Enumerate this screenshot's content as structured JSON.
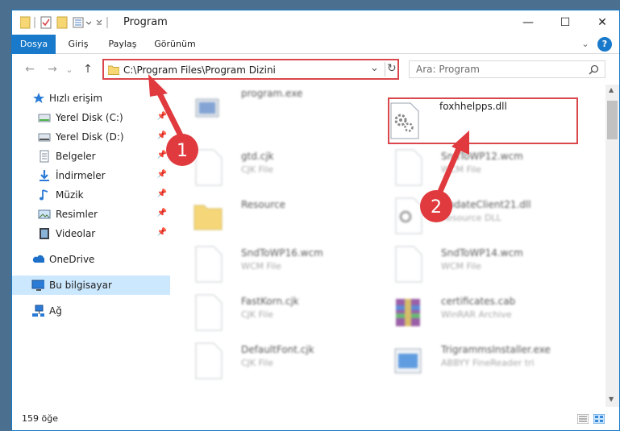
{
  "window": {
    "title": "Program",
    "minimize": "—",
    "maximize": "☐",
    "close": "✕"
  },
  "ribbon": {
    "tabs": [
      {
        "label": "Dosya",
        "active": true
      },
      {
        "label": "Giriş",
        "active": false
      },
      {
        "label": "Paylaş",
        "active": false
      },
      {
        "label": "Görünüm",
        "active": false
      }
    ],
    "expand": "⌄",
    "help": "?"
  },
  "nav": {
    "back": "←",
    "forward": "→",
    "recent": "⌄",
    "up": "↑",
    "address": "C:\\Program Files\\Program Dizini",
    "address_dropdown": "⌄",
    "refresh": "↻",
    "search_placeholder": "Ara: Program"
  },
  "sidebar": {
    "items": [
      {
        "label": "Hızlı erişim",
        "icon": "star-icon",
        "pinned": false
      },
      {
        "label": "Yerel Disk (C:)",
        "icon": "drive-icon",
        "pinned": true
      },
      {
        "label": "Yerel Disk (D:)",
        "icon": "drive-icon",
        "pinned": true
      },
      {
        "label": "Belgeler",
        "icon": "documents-icon",
        "pinned": true
      },
      {
        "label": "İndirmeler",
        "icon": "download-icon",
        "pinned": true
      },
      {
        "label": "Müzik",
        "icon": "music-icon",
        "pinned": true
      },
      {
        "label": "Resimler",
        "icon": "pictures-icon",
        "pinned": true
      },
      {
        "label": "Videolar",
        "icon": "video-icon",
        "pinned": true
      },
      {
        "label": "OneDrive",
        "icon": "cloud-icon",
        "pinned": false
      },
      {
        "label": "Bu bilgisayar",
        "icon": "computer-icon",
        "pinned": false
      },
      {
        "label": "Ağ",
        "icon": "network-icon",
        "pinned": false
      }
    ]
  },
  "files": [
    {
      "name": "program.exe",
      "type": "",
      "icon": "exe-icon",
      "blurred": true
    },
    {
      "name": "foxhhelpps.dll",
      "type": "",
      "icon": "dll-icon",
      "blurred": false
    },
    {
      "name": "gtd.cjk",
      "type": "CJK File",
      "icon": "file-icon",
      "blurred": true
    },
    {
      "name": "SndToWP12.wcm",
      "type": "WCM File",
      "icon": "file-icon",
      "blurred": true
    },
    {
      "name": "Resource",
      "type": "",
      "icon": "folder-icon",
      "blurred": true
    },
    {
      "name": "UpdateClient21.dll",
      "type": "Resource DLL",
      "icon": "dll-icon",
      "blurred": true
    },
    {
      "name": "SndToWP16.wcm",
      "type": "WCM File",
      "icon": "file-icon",
      "blurred": true
    },
    {
      "name": "SndToWP14.wcm",
      "type": "WCM File",
      "icon": "file-icon",
      "blurred": true
    },
    {
      "name": "FastKorn.cjk",
      "type": "CJK File",
      "icon": "file-icon",
      "blurred": true
    },
    {
      "name": "certificates.cab",
      "type": "WinRAR Archive",
      "icon": "archive-icon",
      "blurred": true
    },
    {
      "name": "DefaultFont.cjk",
      "type": "CJK File",
      "icon": "file-icon",
      "blurred": true
    },
    {
      "name": "TrigrammsInstaller.exe",
      "type": "ABBYY FineReader tri",
      "icon": "installer-icon",
      "blurred": true
    }
  ],
  "status": {
    "count": "159 öğe"
  },
  "annotations": {
    "badge1": "1",
    "badge2": "2",
    "color": "#e0393e"
  }
}
